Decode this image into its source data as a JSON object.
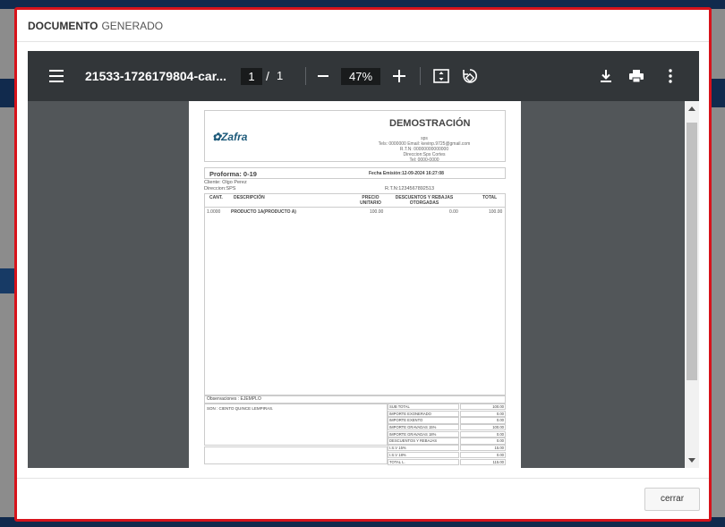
{
  "modal": {
    "title_bold": "DOCUMENTO",
    "title_rest": "GENERADO",
    "close_label": "cerrar",
    "border_color": "#d7131b"
  },
  "viewer": {
    "file_name": "21533-1726179804-car...",
    "current_page": "1",
    "page_separator": "/",
    "total_pages": "1",
    "zoom": "47%",
    "icons": [
      "menu-icon",
      "zoom-out-icon",
      "zoom-in-icon",
      "fit-page-icon",
      "rotate-icon",
      "download-icon",
      "print-icon",
      "more-icon"
    ]
  },
  "document": {
    "logo": "Zafra",
    "company_name": "DEMOSTRACIÓN",
    "company_info": [
      "sps",
      "Tels: 0000000 Email: kevinp.9725@gmail.com",
      "R.T.N: 00000000000000",
      "Direccion:Sps Cortes",
      "Tel: 0000-0000"
    ],
    "proforma": "Proforma: 0-19",
    "fecha": "Fecha Emisión:12-09-2024 16:27:08",
    "cliente": "Cliente: Olgo Perez",
    "direccion": "Direccion:SPS",
    "rtn": "R.T.N:1234567892513",
    "columns": {
      "cant": "CANT.",
      "descripcion": "DESCRIPCIÓN",
      "precio_unitario": "PRECIO UNITARIO",
      "descuentos": "DESCUENTOS Y REBAJAS OTORGADAS",
      "total": "TOTAL"
    },
    "items": [
      {
        "cant": "1.0000",
        "descripcion": "PRODUCTO 1A(PRODUCTO A)",
        "precio": "100.00",
        "descuento": "0.00",
        "total": "100.00"
      }
    ],
    "observaciones": "Observaciones : EJEMPLO",
    "son": "SON : CIENTO QUINCE LEMPIRAS.",
    "totals": [
      {
        "label": "SUB TOTAL",
        "value": "100.00"
      },
      {
        "label": "IMPORTE EXONERADO",
        "value": "0.00"
      },
      {
        "label": "IMPORTE EXENTO",
        "value": "0.00"
      },
      {
        "label": "IMPORTE GRAVADAS 15%",
        "value": "100.00"
      },
      {
        "label": "IMPORTE GRAVADAS 18%",
        "value": "0.00"
      },
      {
        "label": "DESCUENTOS Y REBAJAS",
        "value": "0.00"
      },
      {
        "label": "I.S.V 15%",
        "value": "15.00"
      },
      {
        "label": "I.S.V 18%",
        "value": "0.00"
      },
      {
        "label": "TOTAL L.",
        "value": "115.00"
      }
    ]
  }
}
